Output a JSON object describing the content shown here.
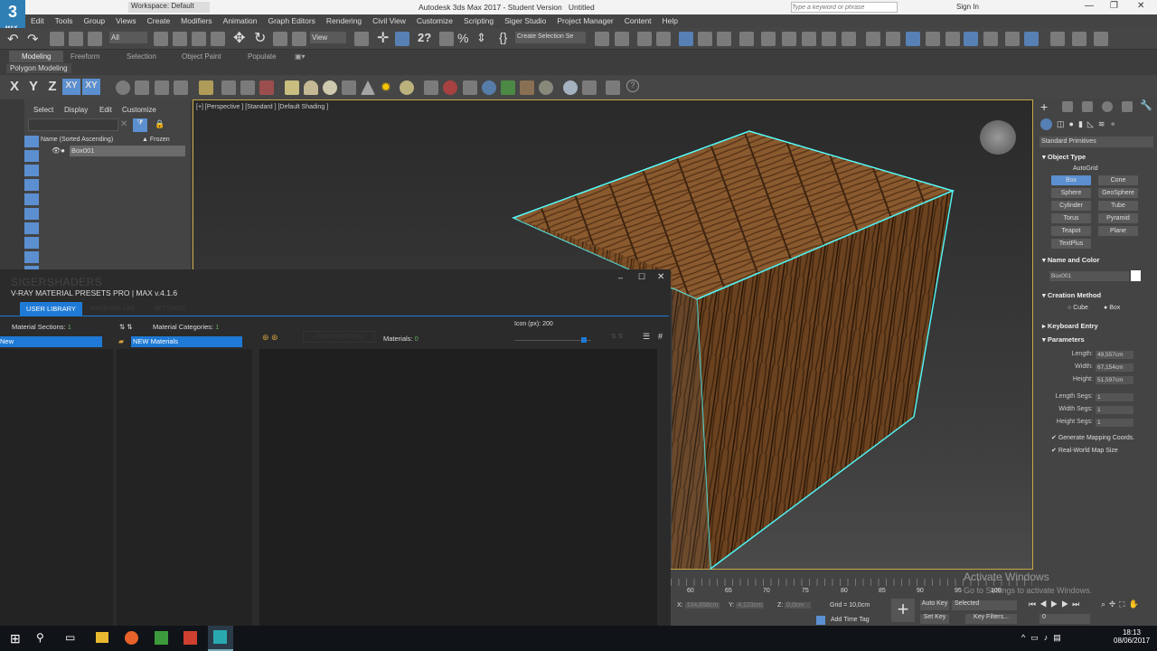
{
  "title": {
    "app": "Autodesk 3ds Max 2017 - Student Version",
    "doc": "Untitled",
    "workspace": "Workspace: Default",
    "search_placeholder": "Type a keyword or phrase",
    "sign_in": "Sign In",
    "logo": "3",
    "logo_sub": "MAX"
  },
  "menu": [
    "Edit",
    "Tools",
    "Group",
    "Views",
    "Create",
    "Modifiers",
    "Animation",
    "Graph Editors",
    "Rendering",
    "Civil View",
    "Customize",
    "Scripting",
    "Siger Studio",
    "Project Manager",
    "Content",
    "Help"
  ],
  "toolbar": {
    "filter": "All",
    "ref_coord": "View",
    "selection_set": "Create Selection Se"
  },
  "ribbon": {
    "tabs": [
      "Modeling",
      "Freeform",
      "Selection",
      "Object Paint",
      "Populate"
    ],
    "panel": "Polygon Modeling"
  },
  "axes": [
    "X",
    "Y",
    "Z",
    "XY",
    "XY"
  ],
  "explorer": {
    "menu": [
      "Select",
      "Display",
      "Edit",
      "Customize"
    ],
    "col_name": "Name (Sorted Ascending)",
    "col_frozen": "▲ Frozen",
    "rows": [
      {
        "name": "Box001"
      }
    ]
  },
  "viewport": {
    "label": "[+] [Perspective ] [Standard ] [Default Shading ]"
  },
  "vray": {
    "brand": "SIGERSHADERS",
    "title": "V-RAY MATERIAL PRESETS PRO | MAX v.4.1.6",
    "tabs": [
      "USER LIBRARY",
      "MATERIAL LAB",
      "SETTINGS"
    ],
    "sections_label": "Material Sections:",
    "sections_count": "1",
    "categories_label": "Material Categories:",
    "categories_count": "1",
    "section_item": "New",
    "category_item": "NEW Materials",
    "assign": "ASSIGN MATERIAL",
    "materials_label": "Materials:",
    "materials_count": "0",
    "icon_size_label": "Icon (px): 200",
    "icon_size": 0.9
  },
  "cmd": {
    "dropdown": "Standard Primitives",
    "object_type": "Object Type",
    "autogrid": "AutoGrid",
    "buttons": [
      "Box",
      "Cone",
      "Sphere",
      "GeoSphere",
      "Cylinder",
      "Tube",
      "Torus",
      "Pyramid",
      "Teapot",
      "Plane",
      "TextPlus"
    ],
    "name_color": "Name and Color",
    "name": "Box001",
    "creation": "Creation Method",
    "cube": "Cube",
    "box": "Box",
    "keyboard": "Keyboard Entry",
    "parameters": "Parameters",
    "params": [
      {
        "label": "Length:",
        "value": "49,557cm"
      },
      {
        "label": "Width:",
        "value": "67,154cm"
      },
      {
        "label": "Height:",
        "value": "51,597cm"
      },
      {
        "label": "Length Segs:",
        "value": "1"
      },
      {
        "label": "Width Segs:",
        "value": "1"
      },
      {
        "label": "Height Segs:",
        "value": "1"
      }
    ],
    "gen_mapping": "Generate Mapping Coords.",
    "real_world": "Real-World Map Size"
  },
  "timeline": {
    "ticks": [
      "60",
      "65",
      "70",
      "75",
      "80",
      "85",
      "90",
      "95",
      "100"
    ]
  },
  "status": {
    "x": "104,858cm",
    "y": "4,123cm",
    "z": "0,0cm",
    "grid": "Grid = 10,0cm",
    "add_time_tag": "Add Time Tag",
    "auto_key": "Auto Key",
    "selected": "Selected",
    "set_key": "Set Key",
    "key_filters": "Key Filters...",
    "frame": "0"
  },
  "watermark": {
    "line1": "Activate Windows",
    "line2": "Go to Settings to activate Windows."
  },
  "clock": {
    "time": "18:13",
    "date": "08/06/2017"
  }
}
